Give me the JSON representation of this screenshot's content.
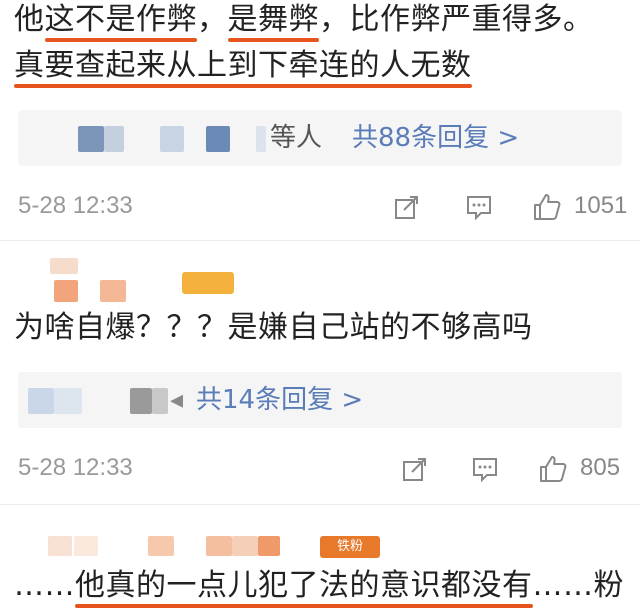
{
  "comments": [
    {
      "lines": [
        {
          "plain_before": "他",
          "underlined": "这不是作弊",
          "plain_mid": "，",
          "underlined2": "是舞弊",
          "plain_after": "，比作弊严重得多。"
        },
        {
          "plain_before": "",
          "underlined": "真要查起来从上到下牵连的人无数",
          "plain_mid": "",
          "underlined2": "",
          "plain_after": ""
        }
      ],
      "reply_users_suffix": "等人",
      "reply_count": "共88条回复 >",
      "timestamp": "5-28 12:33",
      "likes": "1051"
    },
    {
      "badge": "",
      "lines": [
        {
          "plain_before": "为啥自爆？？？是嫌自己站的不够高吗",
          "underlined": "",
          "plain_mid": "",
          "underlined2": "",
          "plain_after": ""
        }
      ],
      "reply_count": "共14条回复 >",
      "timestamp": "5-28 12:33",
      "likes": "805"
    },
    {
      "badge": "铁粉",
      "lines": [
        {
          "plain_before": "……",
          "underlined": "他真的一点儿犯了法的意识都没有",
          "plain_mid": "",
          "underlined2": "",
          "plain_after": "……粉"
        }
      ]
    }
  ],
  "icons": {
    "share": "share-icon",
    "comment": "comment-icon",
    "like": "thumbs-up-icon"
  },
  "colors": {
    "underline": "#e8541e",
    "reply_link": "#5a7cb8",
    "timestamp": "#999999",
    "reply_bg": "#f5f5f6"
  }
}
